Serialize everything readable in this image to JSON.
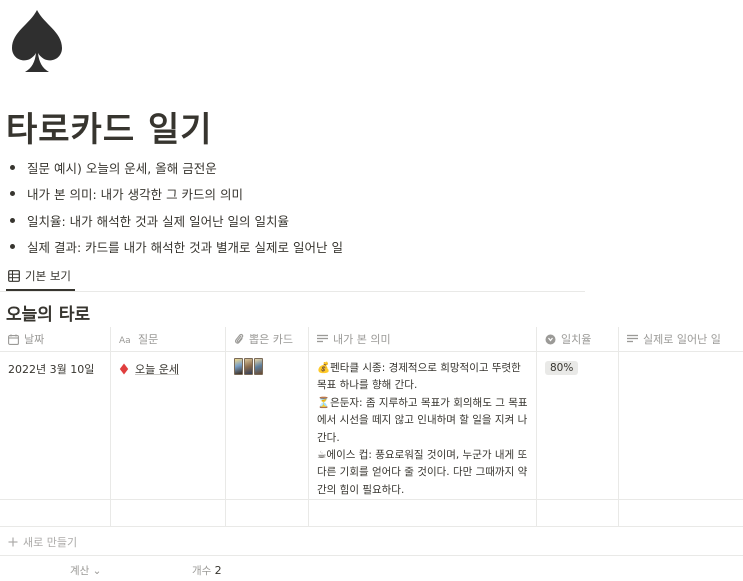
{
  "page": {
    "icon": "spade-icon",
    "title": "타로카드 일기"
  },
  "bullets": [
    "질문 예시) 오늘의 운세, 올해 금전운",
    "내가 본 의미: 내가 생각한 그 카드의 의미",
    "일치율: 내가 해석한 것과 실제 일어난 일의 일치율",
    "실제 결과: 카드를 내가 해석한 것과 별개로 실제로 일어난 일"
  ],
  "view": {
    "tab_label": "기본 보기",
    "icon": "table-icon"
  },
  "database": {
    "title": "오늘의 타로",
    "columns": [
      {
        "label": "날짜",
        "icon": "calendar-icon"
      },
      {
        "label": "질문",
        "icon": "text-title-icon"
      },
      {
        "label": "뽑은 카드",
        "icon": "paperclip-icon"
      },
      {
        "label": "내가 본 의미",
        "icon": "text-lines-icon"
      },
      {
        "label": "일치율",
        "icon": "formula-icon"
      },
      {
        "label": "실제로 일어난 일",
        "icon": "text-lines-icon"
      }
    ],
    "rows": [
      {
        "date": "2022년 3월 10일",
        "question_icon": "diamond-icon",
        "question": "오늘 운세",
        "cards": [
          "tarot-card-1",
          "tarot-card-2",
          "tarot-card-3"
        ],
        "meaning": "💰펜타클 시종: 경제적으로 희망적이고 뚜렷한 목표 하나를 향해 간다.\n⏳은둔자: 좀 지루하고 목표가 회의해도 그 목표에서 시선을 떼지 않고 인내하며 할 일을 지켜 나간다.\n☕에이스 컵: 풍요로워질 것이며, 누군가 내게 또 다른 기회를 얻어다 줄 것이다. 다만 그때까지 약간의 힘이 필요하다.",
        "match_rate": "80%",
        "actual": ""
      }
    ],
    "new_row_label": "새로 만들기",
    "footer": {
      "calc_label": "계산",
      "count_label": "개수",
      "count_value": "2"
    }
  },
  "colors": {
    "text": "#37352f",
    "muted": "#9b9a97",
    "border": "#e9e9e7",
    "badge_bg": "#e9e9e7",
    "diamond": "#e03e3e"
  }
}
